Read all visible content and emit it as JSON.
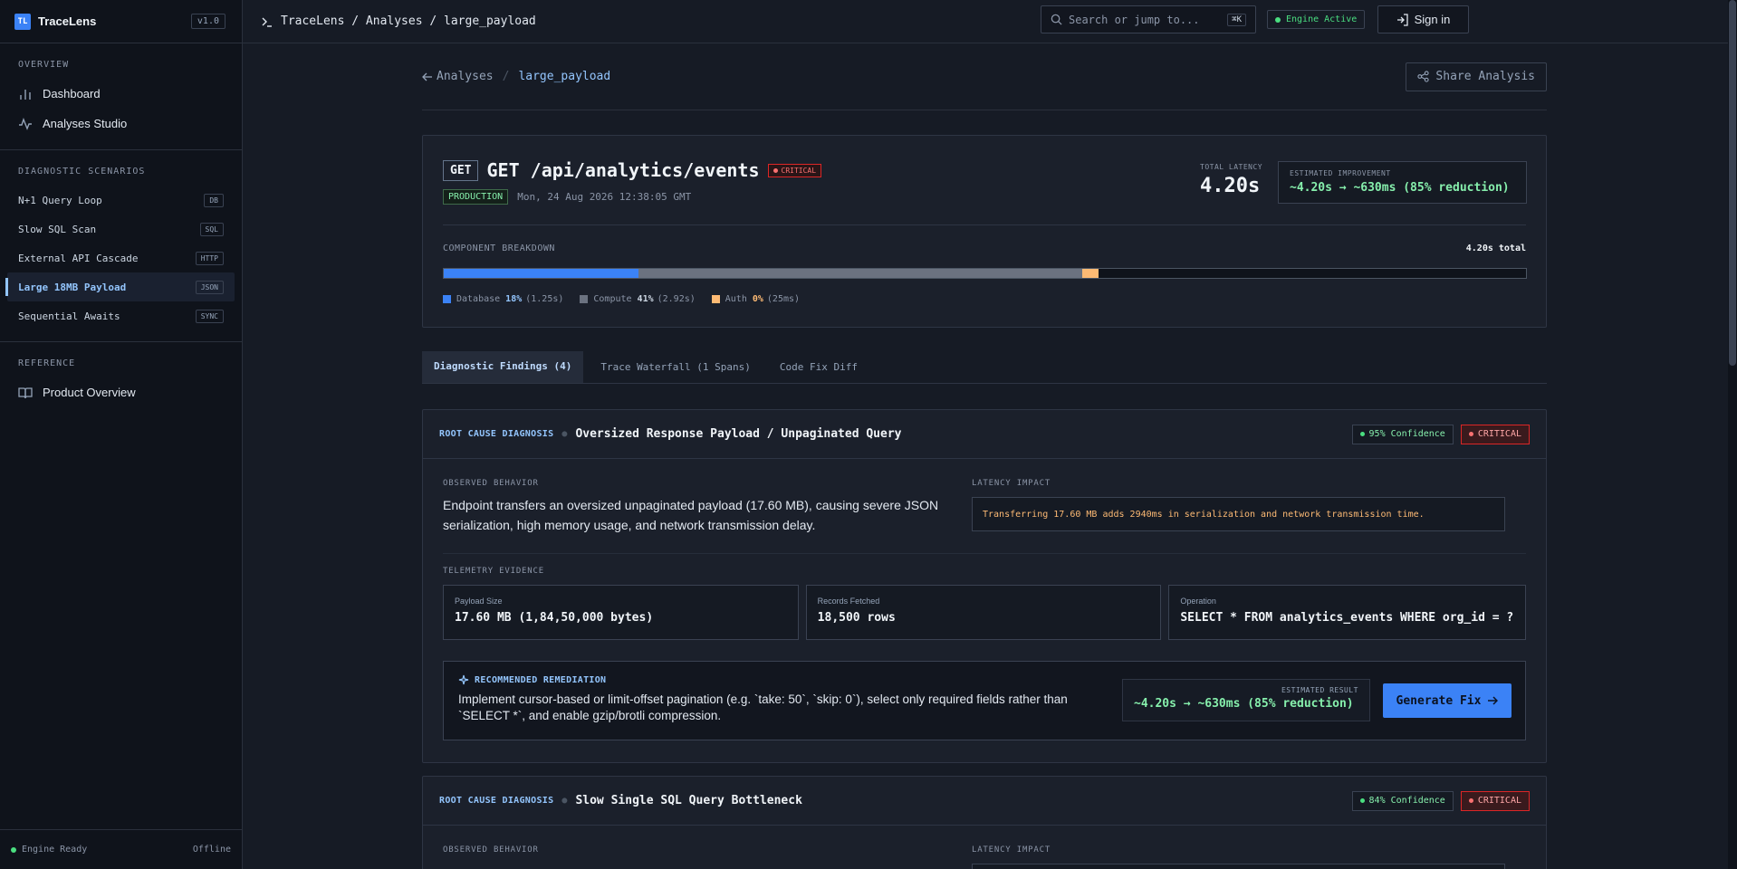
{
  "app": {
    "logo": "TL",
    "name": "TraceLens",
    "version": "v1.0"
  },
  "sidebar": {
    "overview_heading": "OVERVIEW",
    "overview_items": [
      {
        "label": "Dashboard",
        "icon": "bar-chart-icon"
      },
      {
        "label": "Analyses Studio",
        "icon": "activity-icon"
      }
    ],
    "scenarios_heading": "DIAGNOSTIC SCENARIOS",
    "scenarios": [
      {
        "label": "N+1 Query Loop",
        "tag": "DB"
      },
      {
        "label": "Slow SQL Scan",
        "tag": "SQL"
      },
      {
        "label": "External API Cascade",
        "tag": "HTTP"
      },
      {
        "label": "Large 18MB Payload",
        "tag": "JSON",
        "active": true
      },
      {
        "label": "Sequential Awaits",
        "tag": "SYNC"
      }
    ],
    "reference_heading": "REFERENCE",
    "reference_items": [
      {
        "label": "Product Overview",
        "icon": "book-icon"
      }
    ],
    "footer": {
      "status": "Engine Ready",
      "mode": "Offline"
    }
  },
  "topbar": {
    "breadcrumb": "TraceLens / Analyses / large_payload",
    "search_placeholder": "Search or jump to...",
    "search_shortcut": "⌘K",
    "engine_status": "Engine Active",
    "signin_label": "Sign in"
  },
  "page": {
    "back_label": "Analyses",
    "separator": "/",
    "current": "large_payload",
    "share_label": "Share Analysis"
  },
  "summary": {
    "method": "GET",
    "endpoint": "GET /api/analytics/events",
    "severity": "CRITICAL",
    "environment": "PRODUCTION",
    "timestamp": "Mon, 24 Aug 2026 12:38:05 GMT",
    "total_latency_label": "TOTAL LATENCY",
    "total_latency": "4.20s",
    "est_improvement_label": "ESTIMATED IMPROVEMENT",
    "est_improvement": "~4.20s → ~630ms (85% reduction)",
    "breakdown_label": "COMPONENT BREAKDOWN",
    "breakdown_total": "4.20s total",
    "components": [
      {
        "name": "Database",
        "pct": "18%",
        "pct_value": 18,
        "time": "(1.25s)",
        "color": "#3b82f6",
        "pct_color": "#93c5fd"
      },
      {
        "name": "Compute",
        "pct": "41%",
        "pct_value": 41,
        "time": "(2.92s)",
        "color": "#6b7280",
        "pct_color": "#cbd5e1"
      },
      {
        "name": "Auth",
        "pct": "0%",
        "pct_value": 1.5,
        "time": "(25ms)",
        "color": "#fdba74",
        "pct_color": "#fdba74"
      }
    ]
  },
  "tabs": [
    {
      "label": "Diagnostic Findings (4)",
      "active": true
    },
    {
      "label": "Trace Waterfall (1 Spans)"
    },
    {
      "label": "Code Fix Diff"
    }
  ],
  "findings": [
    {
      "kicker": "ROOT CAUSE DIAGNOSIS",
      "title": "Oversized Response Payload / Unpaginated Query",
      "confidence": "95% Confidence",
      "severity": "CRITICAL",
      "observed_label": "OBSERVED BEHAVIOR",
      "observed": "Endpoint transfers an oversized unpaginated payload (17.60 MB), causing severe JSON serialization, high memory usage, and network transmission delay.",
      "impact_label": "LATENCY IMPACT",
      "impact": "Transferring 17.60 MB adds 2940ms in serialization and network transmission time.",
      "telemetry_label": "TELEMETRY EVIDENCE",
      "telemetry": [
        {
          "key": "Payload Size",
          "value": "17.60 MB (1,84,50,000 bytes)"
        },
        {
          "key": "Records Fetched",
          "value": "18,500 rows"
        },
        {
          "key": "Operation",
          "value": "SELECT * FROM analytics_events WHERE org_id = ?"
        }
      ],
      "remediation_label": "RECOMMENDED REMEDIATION",
      "remediation": "Implement cursor-based or limit-offset pagination (e.g. `take: 50`, `skip: 0`), select only required fields rather than `SELECT *`, and enable gzip/brotli compression.",
      "est_result_label": "ESTIMATED RESULT",
      "est_result": "~4.20s → ~630ms (85% reduction)",
      "button": "Generate Fix"
    },
    {
      "kicker": "ROOT CAUSE DIAGNOSIS",
      "title": "Slow Single SQL Query Bottleneck",
      "confidence": "84% Confidence",
      "severity": "CRITICAL",
      "observed_label": "OBSERVED BEHAVIOR",
      "impact_label": "LATENCY IMPACT"
    }
  ]
}
